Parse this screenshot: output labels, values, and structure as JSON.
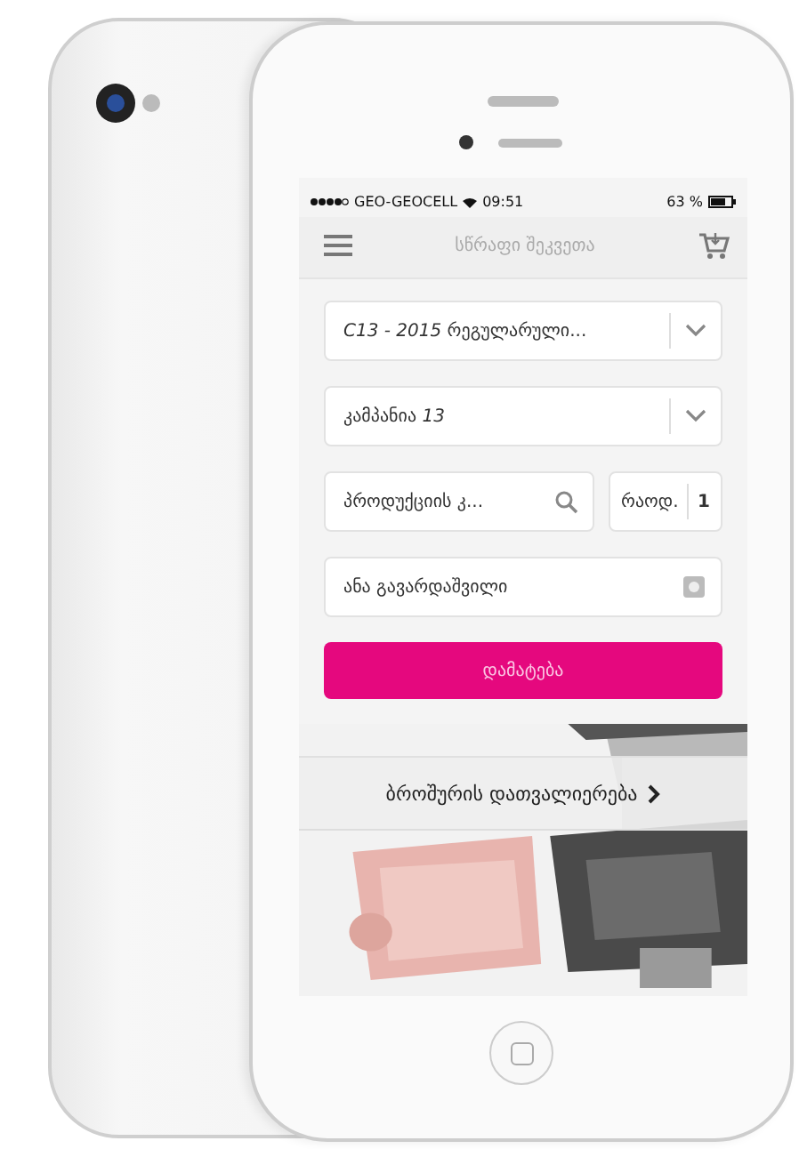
{
  "status_bar": {
    "carrier": "GEO-GEOCELL",
    "time": "09:51",
    "battery": "63 %"
  },
  "nav": {
    "title": "სწრაფი შეკვეთა"
  },
  "dropdowns": [
    {
      "value": "*C13 - 2015* რეგულარული..."
    },
    {
      "value": "კამპანია *13*"
    }
  ],
  "product_search": {
    "placeholder": "პროდუქციის კ..."
  },
  "quantity": {
    "label": "რაოდ.",
    "value": "1"
  },
  "customer_field": {
    "value": "ანა გავარდაშვილი"
  },
  "add_button": "დამატება",
  "brochure_link": "ბროშურის დათვალიერება"
}
